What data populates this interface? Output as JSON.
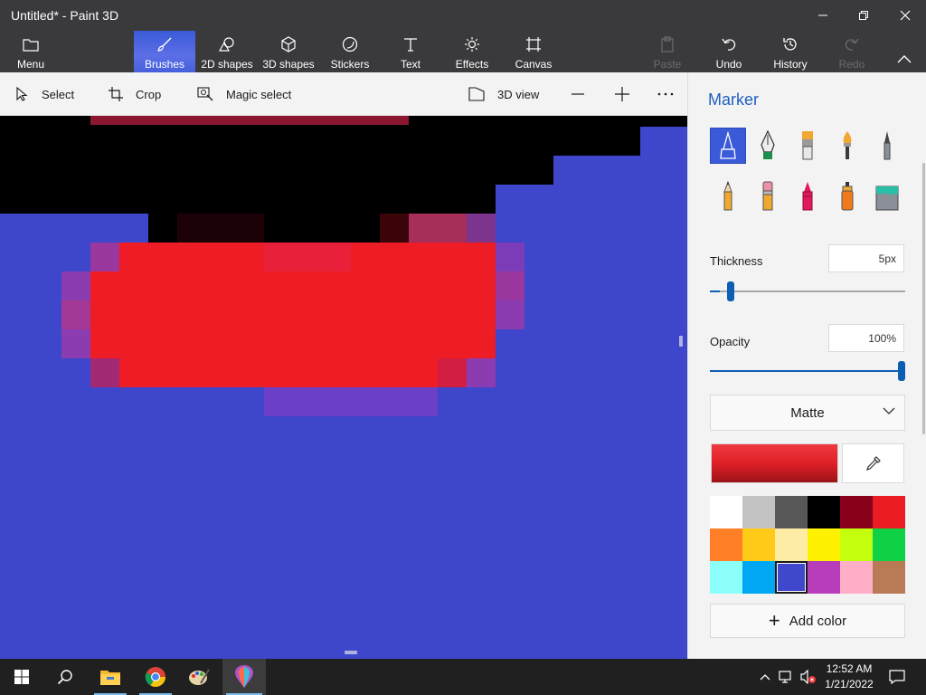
{
  "window": {
    "title": "Untitled* - Paint 3D"
  },
  "ribbon": {
    "menu": "Menu",
    "brushes": "Brushes",
    "shapes2d": "2D shapes",
    "shapes3d": "3D shapes",
    "stickers": "Stickers",
    "text": "Text",
    "effects": "Effects",
    "canvas": "Canvas",
    "paste": "Paste",
    "undo": "Undo",
    "history": "History",
    "redo": "Redo"
  },
  "toolbar": {
    "select": "Select",
    "crop": "Crop",
    "magic_select": "Magic select",
    "view3d": "3D view"
  },
  "panel": {
    "title": "Marker",
    "brushes": [
      "marker-icon",
      "calligraphy-pen-icon",
      "oil-brush-icon",
      "watercolor-icon",
      "pixel-pen-icon",
      "pencil-icon",
      "eraser-icon",
      "crayon-icon",
      "spray-can-icon",
      "fill-icon"
    ],
    "selected_brush": "Marker",
    "thickness_label": "Thickness",
    "thickness_value": "5px",
    "thickness_level": 0.05,
    "opacity_label": "Opacity",
    "opacity_value": "100%",
    "opacity_level": 1.0,
    "finish": "Matte",
    "current_color": "#e02027",
    "palette": [
      "#ffffff",
      "#c3c3c3",
      "#585858",
      "#000000",
      "#88001b",
      "#ec1c24",
      "#ff7f27",
      "#ffca18",
      "#fdeca6",
      "#fff200",
      "#c4ff0e",
      "#0ed145",
      "#8cfffb",
      "#00a8f3",
      "#3f48cc",
      "#b83dba",
      "#ffaec8",
      "#b97a56"
    ],
    "selected_palette_color": "#3f48cc",
    "add_color": "Add color"
  },
  "canvas": {
    "background": "#3e46cb",
    "colors": {
      "blue": "#3e46cb",
      "black": "#000000",
      "red": "#ee1c25",
      "dark_red": "#8b1630"
    }
  },
  "taskbar": {
    "apps": [
      "start-icon",
      "search-icon",
      "file-explorer-icon",
      "chrome-icon",
      "paint-icon",
      "paint3d-icon"
    ],
    "time": "12:52 AM",
    "date": "1/21/2022"
  }
}
